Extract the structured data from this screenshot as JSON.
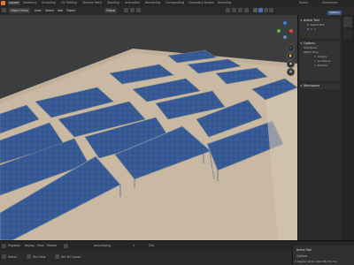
{
  "workspaces": {
    "tabs": [
      "Layout",
      "Modeling",
      "Sculpting",
      "UV Editing",
      "Texture Paint",
      "Shading",
      "Animation",
      "Rendering",
      "Compositing",
      "Geometry Nodes",
      "Scripting"
    ],
    "active": "Layout",
    "scene_label": "Scene",
    "view_layer_label": "ViewLayer"
  },
  "header": {
    "mode": "Object Mode",
    "menu": [
      "View",
      "Select",
      "Add",
      "Object"
    ],
    "global_label": "Global",
    "options_label": "Options"
  },
  "npanel": {
    "tool_button": "Options",
    "active_tool": {
      "title": "Active Tool",
      "select_box": "Select Box"
    },
    "options": {
      "title": "Options",
      "transform_label": "Transform",
      "affect_only_label": "Affect Only",
      "origins_label": "Origins",
      "locations_label": "Locations",
      "parents_label": "Parents"
    },
    "workspace": {
      "title": "Workspace"
    }
  },
  "bottom": {
    "playback_label": "Playback",
    "keying_label": "Keying",
    "view_label": "View",
    "marker_label": "Marker",
    "auto_keying": "Auto Keying",
    "start_frame": "1",
    "end_frame": "250",
    "status_left": [
      "Select",
      "Pan View",
      "Set 3D Cursor"
    ],
    "aside_title": "Active Tool",
    "aside_line": "Options",
    "version": "1 Objects | Verts 1,816,798 | Tris 3.6"
  },
  "colors": {
    "ground": "#c9b9a2",
    "panel_blue": "#3d5a88",
    "panel_frame": "#7f8a95"
  }
}
